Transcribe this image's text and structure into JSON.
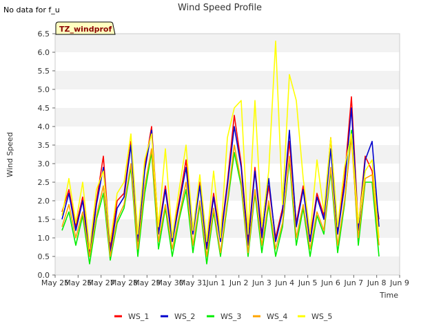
{
  "chart_data": {
    "type": "line",
    "title": "Wind Speed Profile",
    "note": "No data for f_u",
    "badge": "TZ_windprof",
    "xlabel": "Time",
    "ylabel": "Wind Speed",
    "ylim": [
      0,
      6.5
    ],
    "yticks": [
      0.0,
      0.5,
      1.0,
      1.5,
      2.0,
      2.5,
      3.0,
      3.5,
      4.0,
      4.5,
      5.0,
      5.5,
      6.0,
      6.5
    ],
    "ytick_labels": [
      "0.0",
      "0.5",
      "1.0",
      "1.5",
      "2.0",
      "2.5",
      "3.0",
      "3.5",
      "4.0",
      "4.5",
      "5.0",
      "5.5",
      "6.0",
      "6.5"
    ],
    "xlim": [
      "2024-05-25",
      "2024-06-09"
    ],
    "xticks": [
      "May 25",
      "May 26",
      "May 27",
      "May 28",
      "May 29",
      "May 30",
      "May 31",
      "Jun 1",
      "Jun 2",
      "Jun 3",
      "Jun 4",
      "Jun 5",
      "Jun 6",
      "Jun 7",
      "Jun 8",
      "Jun 9"
    ],
    "grid": "horizontal bands",
    "legend_position": "bottom-center",
    "x_days": [
      0.3,
      0.6,
      0.9,
      1.2,
      1.5,
      1.8,
      2.1,
      2.4,
      2.7,
      3.0,
      3.3,
      3.6,
      3.9,
      4.2,
      4.5,
      4.8,
      5.1,
      5.4,
      5.7,
      6.0,
      6.3,
      6.6,
      6.9,
      7.2,
      7.5,
      7.8,
      8.1,
      8.4,
      8.7,
      9.0,
      9.3,
      9.6,
      9.9,
      10.2,
      10.5,
      10.8,
      11.1,
      11.4,
      11.7,
      12.0,
      12.3,
      12.6,
      12.9,
      13.2,
      13.5,
      13.8,
      14.1
    ],
    "series": [
      {
        "name": "WS_1",
        "color": "#ff0000",
        "values": [
          1.7,
          2.3,
          1.3,
          2.1,
          0.6,
          2.0,
          3.2,
          0.7,
          2.0,
          2.2,
          3.6,
          1.0,
          2.9,
          4.0,
          1.2,
          2.4,
          1.0,
          2.0,
          3.1,
          1.2,
          2.5,
          0.8,
          2.2,
          1.0,
          2.5,
          4.3,
          3.0,
          0.9,
          2.9,
          1.1,
          2.4,
          1.0,
          1.8,
          3.6,
          1.4,
          2.4,
          1.0,
          2.2,
          1.6,
          3.7,
          1.2,
          2.6,
          4.8,
          1.3,
          3.2,
          2.8,
          1.5
        ]
      },
      {
        "name": "WS_2",
        "color": "#0000cd",
        "values": [
          1.5,
          2.2,
          1.2,
          2.0,
          0.5,
          1.9,
          2.9,
          0.6,
          1.8,
          2.1,
          3.5,
          0.9,
          2.8,
          3.9,
          1.1,
          2.3,
          0.9,
          1.9,
          2.9,
          1.1,
          2.4,
          0.7,
          2.1,
          0.9,
          2.4,
          4.0,
          2.9,
          0.8,
          2.8,
          1.0,
          2.6,
          0.9,
          1.7,
          3.9,
          1.3,
          2.3,
          0.9,
          2.1,
          1.5,
          3.4,
          1.1,
          2.4,
          4.5,
          1.2,
          3.1,
          3.6,
          1.3
        ]
      },
      {
        "name": "WS_3",
        "color": "#00ee00",
        "values": [
          1.2,
          1.7,
          0.8,
          1.6,
          0.3,
          1.5,
          2.2,
          0.4,
          1.4,
          1.8,
          2.9,
          0.5,
          2.2,
          3.3,
          0.7,
          1.8,
          0.5,
          1.5,
          2.3,
          0.6,
          1.9,
          0.3,
          1.7,
          0.5,
          1.9,
          3.3,
          2.4,
          0.5,
          2.2,
          0.6,
          1.9,
          0.5,
          1.3,
          3.1,
          0.8,
          1.8,
          0.5,
          1.6,
          1.1,
          2.8,
          0.6,
          1.9,
          3.9,
          0.8,
          2.5,
          2.5,
          0.5
        ]
      },
      {
        "name": "WS_4",
        "color": "#ffa500",
        "values": [
          1.3,
          1.9,
          1.0,
          1.7,
          0.5,
          1.6,
          2.4,
          0.5,
          1.5,
          1.9,
          3.0,
          0.7,
          2.4,
          3.4,
          0.9,
          1.9,
          0.7,
          1.6,
          2.5,
          0.8,
          2.0,
          0.5,
          1.8,
          0.6,
          2.0,
          3.5,
          2.5,
          0.6,
          2.3,
          0.8,
          2.0,
          0.7,
          1.4,
          3.2,
          1.0,
          1.9,
          0.7,
          1.7,
          1.2,
          2.9,
          0.8,
          2.0,
          3.7,
          1.0,
          2.6,
          2.7,
          0.8
        ]
      },
      {
        "name": "WS_5",
        "color": "#ffff00",
        "values": [
          1.6,
          2.6,
          1.4,
          2.5,
          0.7,
          2.3,
          2.8,
          0.9,
          2.2,
          2.5,
          3.8,
          1.1,
          3.1,
          3.8,
          1.3,
          3.4,
          1.0,
          2.3,
          3.5,
          1.2,
          2.7,
          0.9,
          2.8,
          1.0,
          3.7,
          4.5,
          4.7,
          1.1,
          4.7,
          1.3,
          2.8,
          6.3,
          1.9,
          5.4,
          4.7,
          2.6,
          1.1,
          3.1,
          1.7,
          3.7,
          1.3,
          2.9,
          3.8,
          1.4,
          2.8,
          3.1,
          1.0
        ]
      }
    ]
  }
}
